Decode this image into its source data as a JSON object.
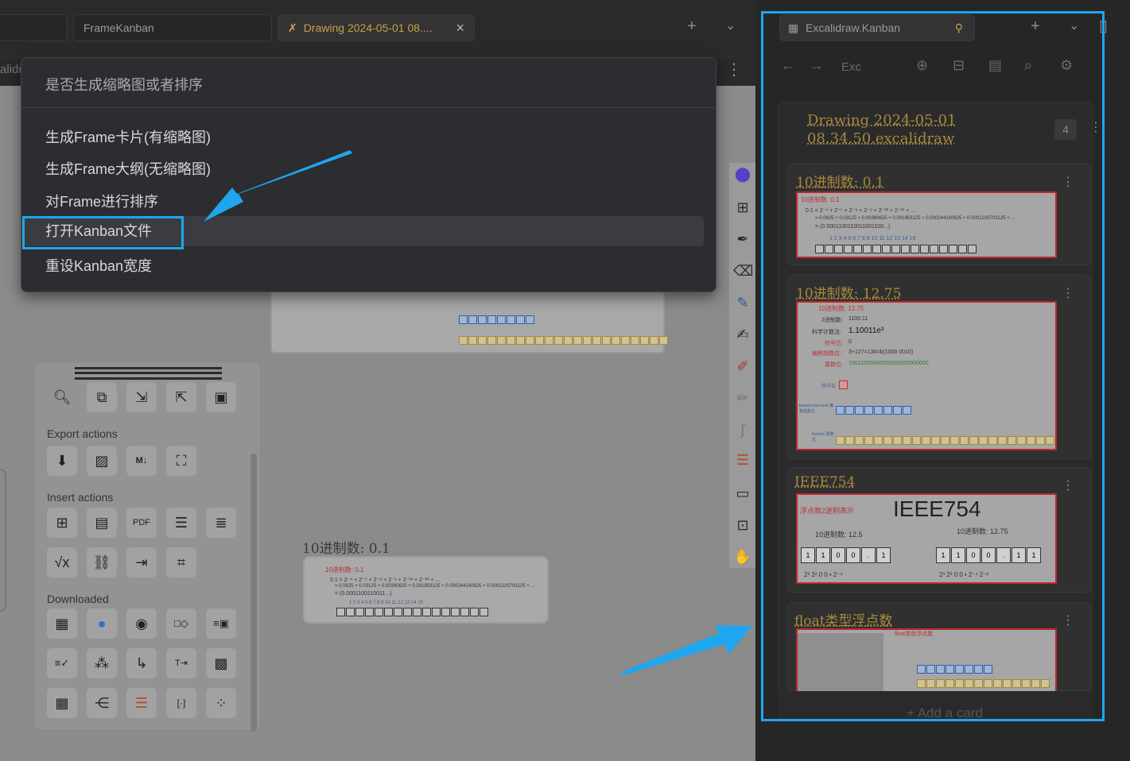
{
  "left_tabs": {
    "tab2": "FrameKanban",
    "tab3": "Drawing 2024-05-01 08....",
    "crumb": "alidr"
  },
  "menu": {
    "title": "是否生成缩略图或者排序",
    "items": [
      "生成Frame卡片(有缩略图)",
      "生成Frame大纲(无缩略图)",
      "对Frame进行排序",
      "打开Kanban文件",
      "重设Kanban宽度"
    ]
  },
  "tools": {
    "export_label": "Export actions",
    "insert_label": "Insert actions",
    "downloaded_label": "Downloaded"
  },
  "canvas_card": {
    "label": "10进制数: 0.1",
    "red": "10进制数: 0.1",
    "line1": "0.1 = 2⁻⁴ + 2⁻⁵ + 2⁻⁸ + 2⁻⁹ + 2⁻¹² + 2⁻¹³ + ...",
    "line2": "= 0.0625 + 0.03125 + 0.00390625 + 0.001953125 + 0.000244140625 + 0.0001220703125 + ...",
    "line3": "= (0.0001100110011...)",
    "indices": "1  2  3  4  5  6  7  8  9  10  11  12  13  14  15"
  },
  "right": {
    "tab_title": "Excalidraw.Kanban",
    "breadcrumb": "Exc",
    "lane_title": "Drawing 2024-05-01 08.34.50.excalidraw",
    "lane_count": "4",
    "add_card": "+ Add a card",
    "cards": [
      {
        "title": "10进制数: 0.1",
        "red": "10进制数: 0.1",
        "line1": "0.1 = 2⁻⁴ + 2⁻⁵ + 2⁻⁸ + 2⁻⁹ + 2⁻¹² + 2⁻¹³ + ...",
        "line2": "= 0.0625 + 0.03125 + 0.00390625 + 0.001953125 + 0.000244140625 + 0.0001220703125 + ...",
        "line3": "= (0.0001100110011001100...)",
        "indices": "1  2  3  4  5  6  7  8  9  10  11  12  13  14  15"
      },
      {
        "title": "10进制数: 12.75",
        "r1": "10进制数: 12.75",
        "r2": "2进制数:",
        "v2": "1100.11",
        "r3": "科学计数法:",
        "v3": "1.10011e³",
        "r4": "符号位:",
        "v4": "0",
        "r5": "偏移指数位:",
        "v5": "3+127=130=b(1000 0010)",
        "r6": "尾数位:",
        "v6": "10011000000000000000000000",
        "sign": "符号位",
        "exp": "biased exponent 偏移指数位",
        "frac": "fraction 尾数位"
      },
      {
        "title": "IEEE754",
        "big": "IEEE754",
        "red": "浮点数2进制表示",
        "a": "10进制数: 12.5",
        "b": "10进制数: 12.75",
        "bits_a": [
          "1",
          "1",
          "0",
          "0",
          ".",
          "1"
        ],
        "bits_b": [
          "1",
          "1",
          "0",
          "0",
          ".",
          "1",
          "1"
        ],
        "pow_a": "2³   2²   0    0   •   2⁻¹",
        "pow_b": "2³   2²   0    0   •   2⁻¹  2⁻²"
      },
      {
        "title": "float类型浮点数",
        "red": "float类型浮点数"
      }
    ]
  }
}
